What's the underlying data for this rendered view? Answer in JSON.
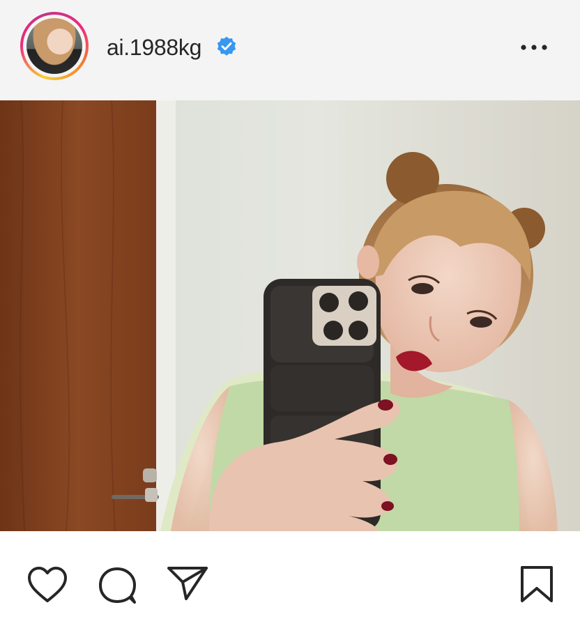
{
  "post": {
    "username": "ai.1988kg",
    "verified": true,
    "accent_color": "#3897f0"
  },
  "icons": {
    "more": "more-horizontal-icon",
    "like": "heart-icon",
    "comment": "comment-icon",
    "share": "send-icon",
    "save": "bookmark-icon"
  }
}
